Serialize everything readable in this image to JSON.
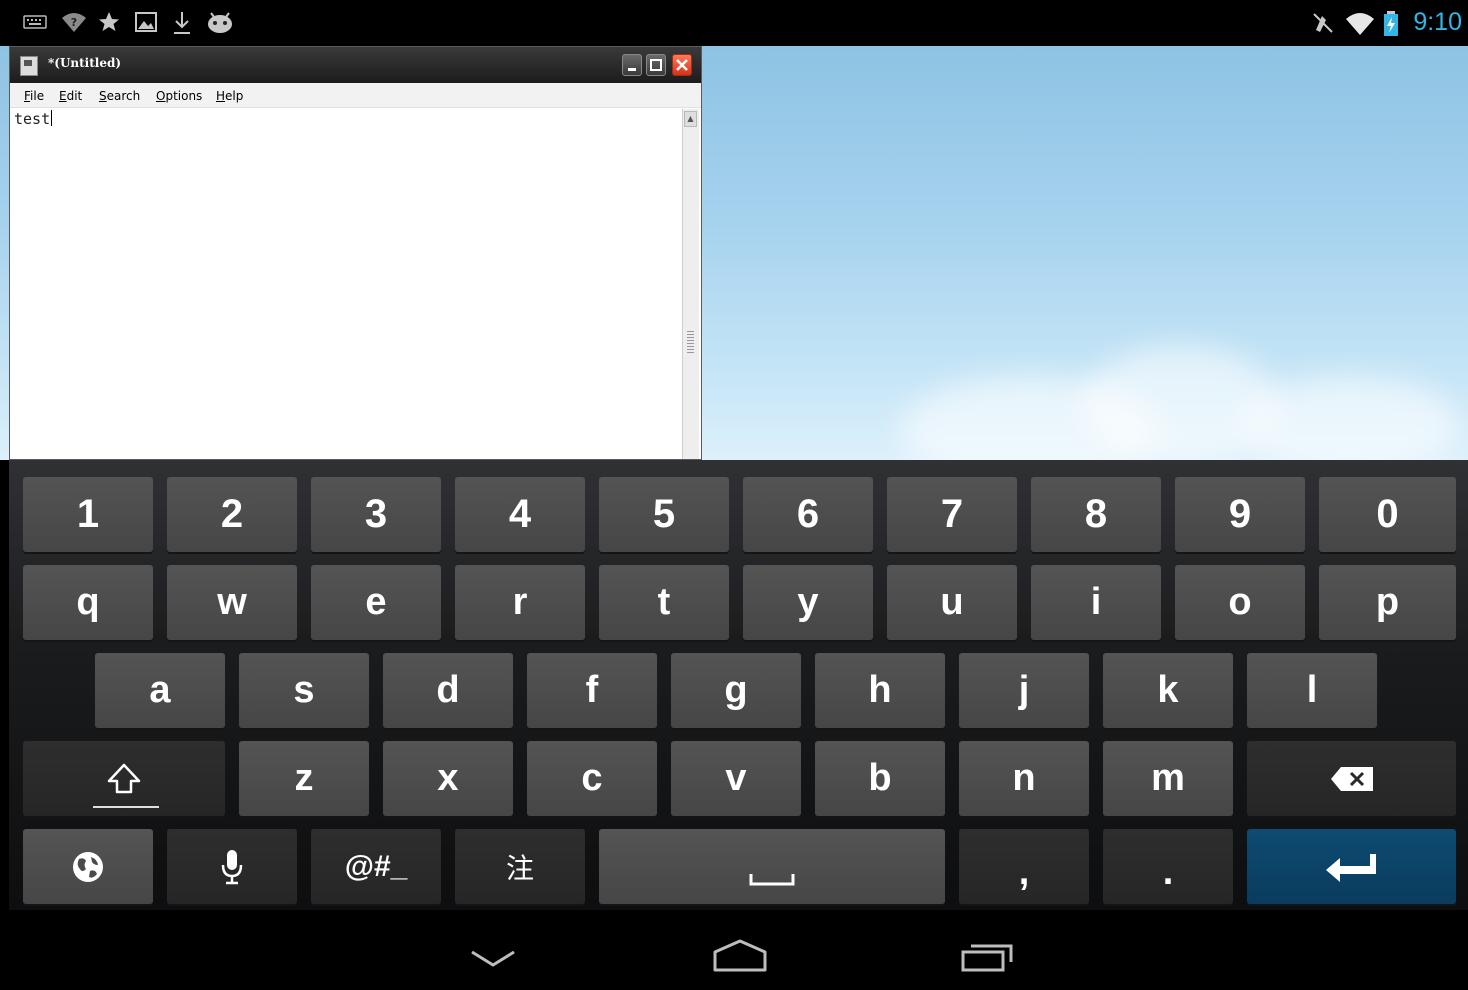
{
  "status_bar": {
    "left_icons": [
      "keyboard-icon",
      "wifi-question-icon",
      "star-icon",
      "image-icon",
      "download-icon",
      "android-icon"
    ],
    "right_icons": [
      "mute-icon",
      "wifi-icon",
      "battery-charging-icon"
    ],
    "time": "9:10"
  },
  "editor": {
    "title": "*(Untitled)",
    "menu": [
      "File",
      "Edit",
      "Search",
      "Options",
      "Help"
    ],
    "text": "test"
  },
  "keyboard": {
    "rows": [
      [
        "1",
        "2",
        "3",
        "4",
        "5",
        "6",
        "7",
        "8",
        "9",
        "0"
      ],
      [
        "q",
        "w",
        "e",
        "r",
        "t",
        "y",
        "u",
        "i",
        "o",
        "p"
      ],
      [
        "a",
        "s",
        "d",
        "f",
        "g",
        "h",
        "j",
        "k",
        "l"
      ],
      [
        "z",
        "x",
        "c",
        "v",
        "b",
        "n",
        "m"
      ]
    ],
    "bottom": {
      "symbols_label": "@#_",
      "cjk_label": "注",
      "comma_label": ",",
      "period_label": "."
    },
    "icons": {
      "shift": "shift-icon",
      "backspace": "backspace-icon",
      "language": "globe-icon",
      "voice": "microphone-icon",
      "space": "spacebar-icon",
      "enter": "enter-icon"
    },
    "colors": {
      "key": "#4d4d4d",
      "dark_key": "#2a2a2a",
      "enter_key": "#0b4266"
    }
  },
  "nav_bar": {
    "icons": [
      "back-icon",
      "home-icon",
      "recent-apps-icon"
    ]
  },
  "colors": {
    "accent": "#33b5e5",
    "close_button": "#e0482a"
  }
}
